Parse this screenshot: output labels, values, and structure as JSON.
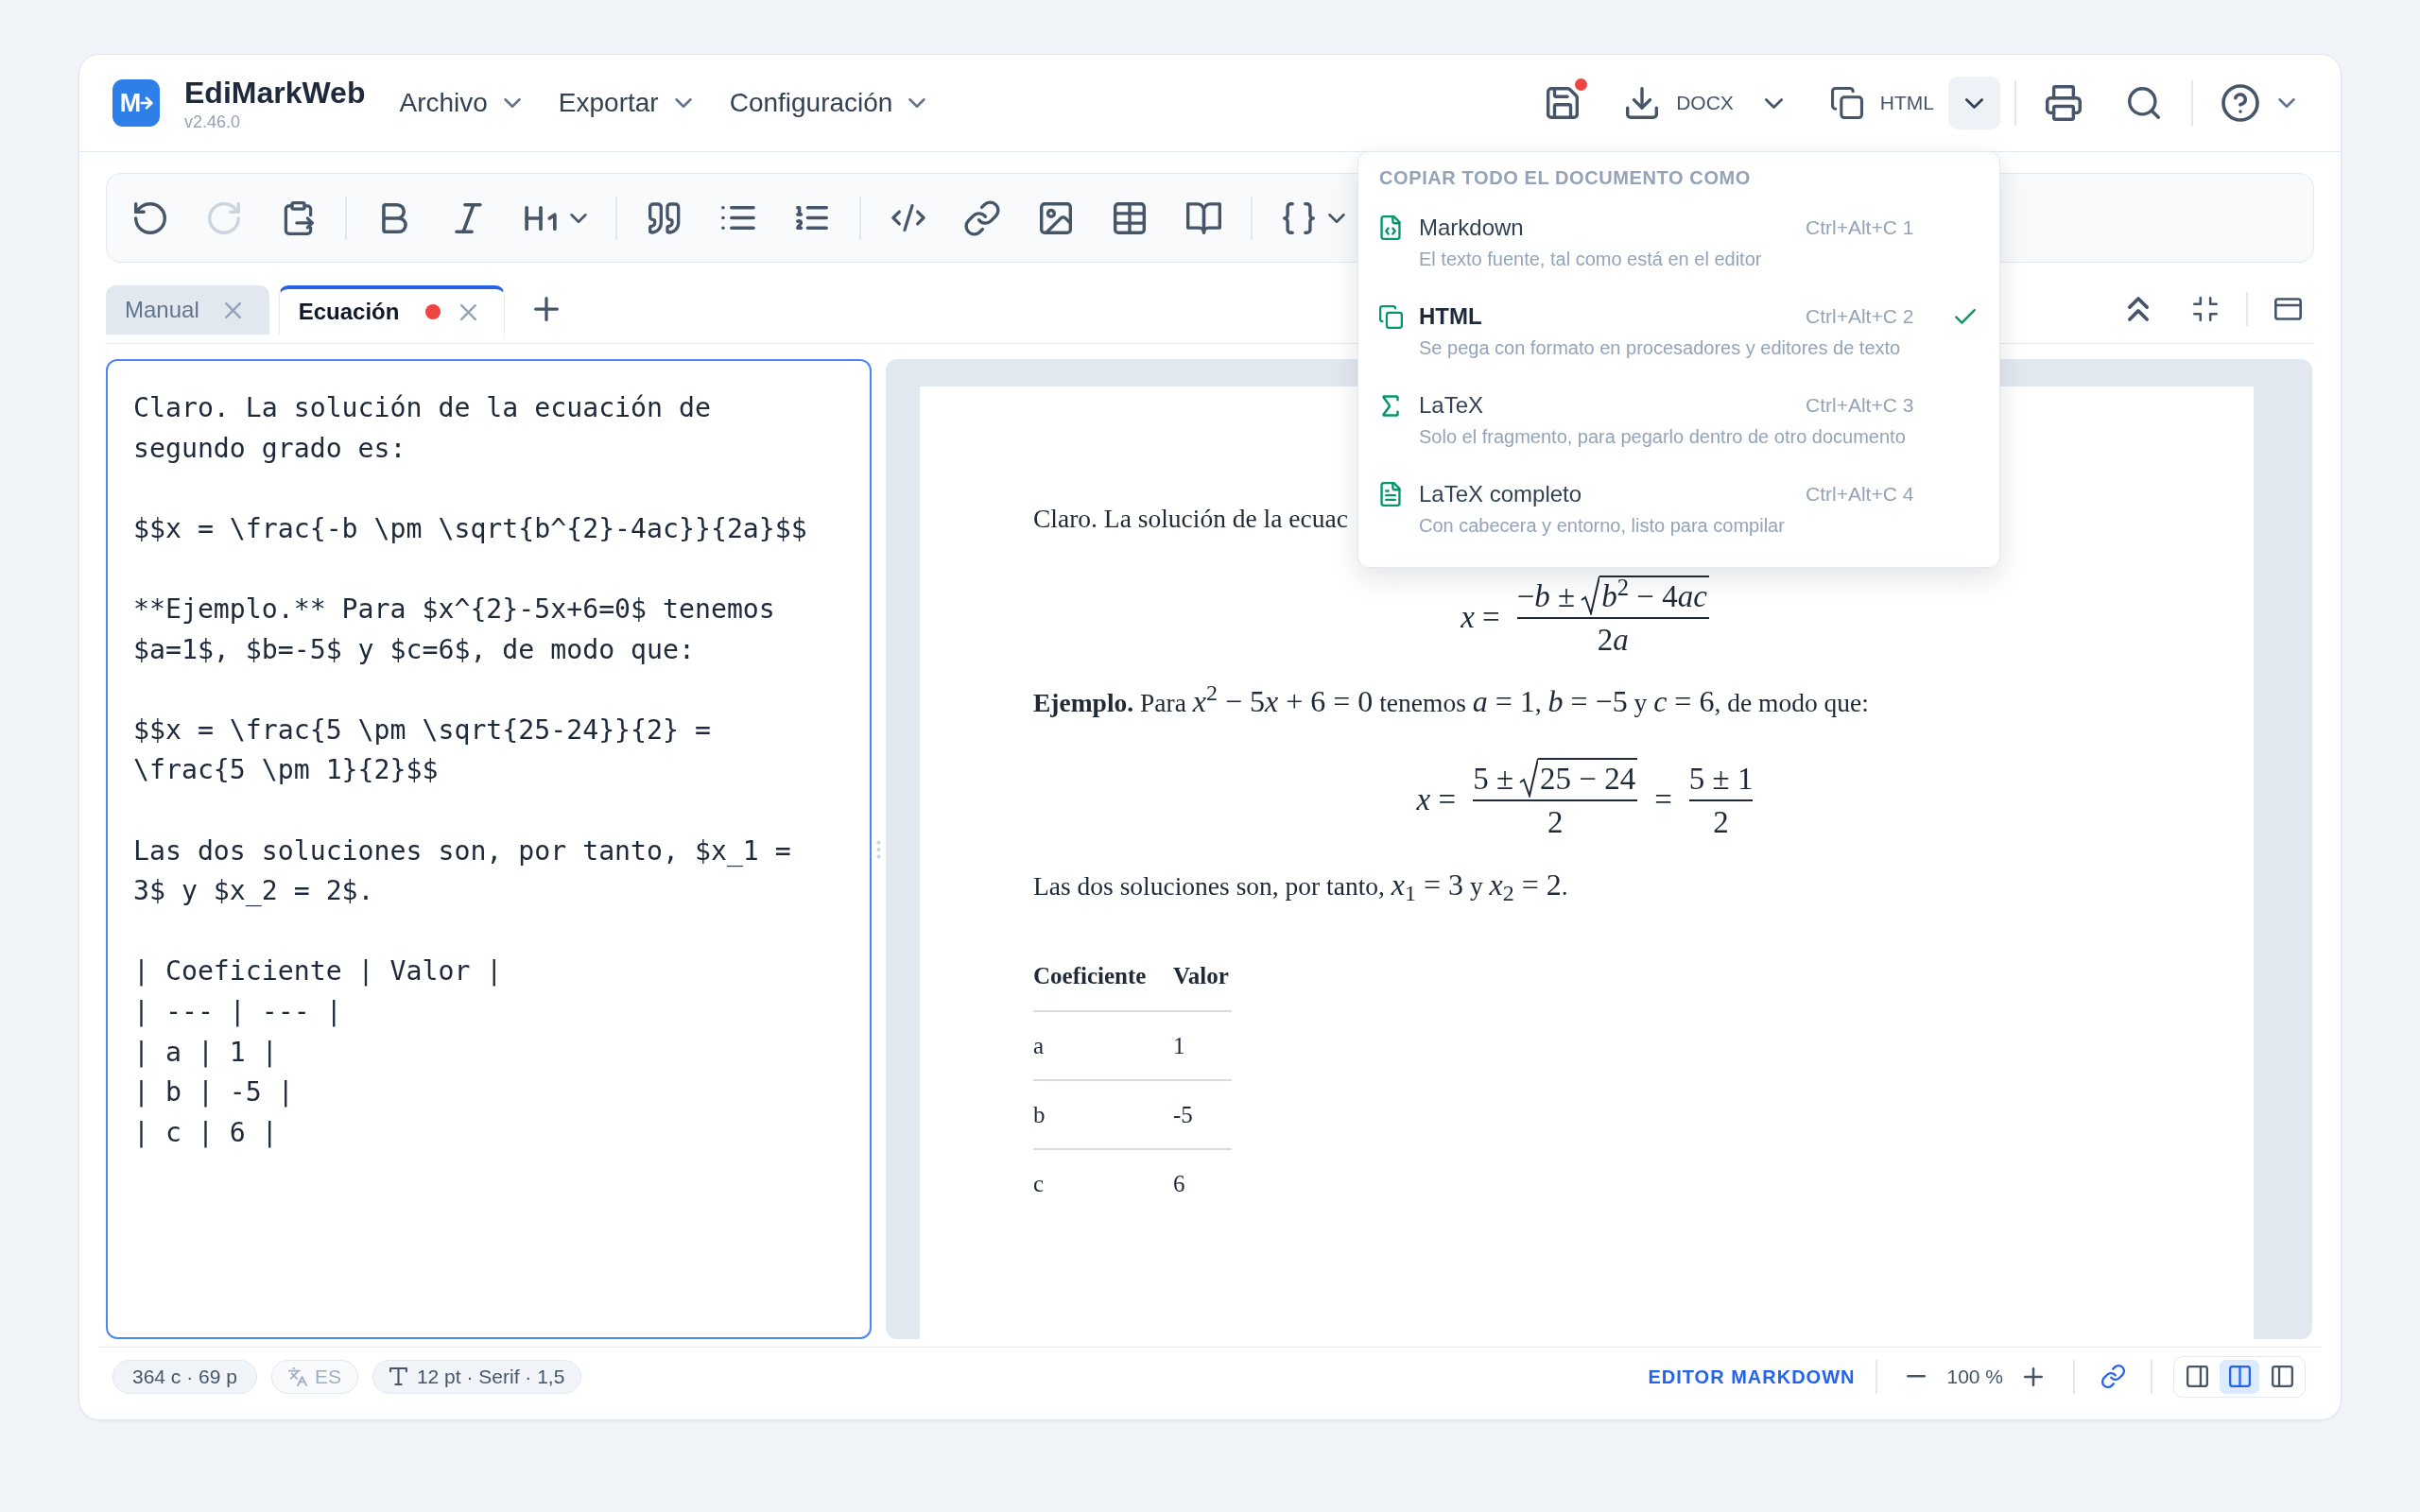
{
  "app": {
    "logo_letter": "M",
    "name": "EdiMarkWeb",
    "version": "v2.46.0"
  },
  "menus": [
    {
      "label": "Archivo"
    },
    {
      "label": "Exportar"
    },
    {
      "label": "Configuración"
    }
  ],
  "header": {
    "save": {
      "unsaved": true
    },
    "export": {
      "label": "DOCX"
    },
    "copy": {
      "label": "HTML"
    }
  },
  "toolbar": {
    "groups": [
      [
        {
          "kind": "undo",
          "disabled": false
        },
        {
          "kind": "redo",
          "disabled": true
        },
        {
          "kind": "paste",
          "disabled": false
        }
      ],
      [
        {
          "kind": "bold",
          "disabled": false
        },
        {
          "kind": "italic",
          "disabled": false
        },
        {
          "kind": "heading",
          "disabled": false
        }
      ],
      [
        {
          "kind": "quote",
          "disabled": false
        },
        {
          "kind": "bullet_list",
          "disabled": false
        },
        {
          "kind": "numbered_list",
          "disabled": false
        }
      ],
      [
        {
          "kind": "code",
          "disabled": false
        },
        {
          "kind": "link",
          "disabled": false
        },
        {
          "kind": "image",
          "disabled": false
        },
        {
          "kind": "table",
          "disabled": false
        },
        {
          "kind": "book",
          "disabled": false
        }
      ],
      [
        {
          "kind": "braces",
          "disabled": false
        }
      ]
    ]
  },
  "tabs": [
    {
      "label": "Manual",
      "selected": false,
      "modified": false
    },
    {
      "label": "Ecuación",
      "selected": true,
      "modified": true
    }
  ],
  "editor": {
    "blocks": [
      [
        "Claro. La solución de la ecuación de",
        "segundo grado es:"
      ],
      [
        "$$x = \\frac{-b \\pm \\sqrt{b^{2}-4ac}}{2a}$$"
      ],
      [
        "**Ejemplo.** Para $x^{2}-5x+6=0$ tenemos",
        "$a=1$, $b=-5$ y $c=6$, de modo que:"
      ],
      [
        "$$x = \\frac{5 \\pm \\sqrt{25-24}}{2} =",
        "\\frac{5 \\pm 1}{2}$$"
      ],
      [
        "Las dos soluciones son, por tanto, $x_1 =",
        "3$ y $x_2 = 2$."
      ],
      [
        "| Coeficiente | Valor |",
        "| --- | --- |",
        "| a | 1 |",
        "| b | -5 |",
        "| c | 6 |"
      ]
    ]
  },
  "preview": {
    "blocks": [
      {
        "kind": "paragraph",
        "runs": [
          {
            "kind": "text",
            "text": "Claro. La solución de la ecuac"
          }
        ]
      },
      {
        "kind": "display_math",
        "parts": [
          {
            "kind": "text",
            "text": "x ="
          },
          {
            "kind": "fraction",
            "numerator": "−b ±",
            "radicand": "b$^{2}$ − 4ac",
            "denominator": "2a"
          }
        ]
      },
      {
        "kind": "paragraph",
        "runs": [
          {
            "kind": "text",
            "text": "**Ejemplo.** Para "
          },
          {
            "kind": "math",
            "text": "x$^{2}$ − 5x + 6 = 0"
          },
          {
            "kind": "text",
            "text": " tenemos "
          },
          {
            "kind": "math",
            "text": "a = 1"
          },
          {
            "kind": "text",
            "text": ", "
          },
          {
            "kind": "math",
            "text": "b = −5"
          },
          {
            "kind": "text",
            "text": " y "
          },
          {
            "kind": "math",
            "text": "c = 6"
          },
          {
            "kind": "text",
            "text": ", de modo que:"
          }
        ]
      },
      {
        "kind": "display_math",
        "parts": [
          {
            "kind": "text",
            "text": "x ="
          },
          {
            "kind": "fraction",
            "numerator": "5 ±",
            "radicand": "25 − 24",
            "denominator": "2"
          },
          {
            "kind": "text",
            "text": "="
          },
          {
            "kind": "fraction",
            "numerator": "5 ± 1",
            "denominator": "2"
          }
        ]
      },
      {
        "kind": "paragraph",
        "runs": [
          {
            "kind": "text",
            "text": "Las dos soluciones son, por tanto, "
          },
          {
            "kind": "math",
            "text": "x$_{1}$ = 3"
          },
          {
            "kind": "text",
            "text": " y "
          },
          {
            "kind": "math",
            "text": "x$_{2}$ = 2"
          },
          {
            "kind": "text",
            "text": "."
          }
        ]
      },
      {
        "kind": "table",
        "columns": [
          "Coeficiente",
          "Valor"
        ],
        "rows": [
          [
            "a",
            "1"
          ],
          [
            "b",
            "-5"
          ],
          [
            "c",
            "6"
          ]
        ]
      }
    ]
  },
  "copy_menu": {
    "open": true,
    "heading": "COPIAR TODO EL DOCUMENTO COMO",
    "items": [
      {
        "kind": "markdown",
        "title": "Markdown",
        "shortcut": "Ctrl+Alt+C 1",
        "description": "El texto fuente, tal como está en el editor",
        "selected": false
      },
      {
        "kind": "html",
        "title": "HTML",
        "shortcut": "Ctrl+Alt+C 2",
        "description": "Se pega con formato en procesadores y editores de texto",
        "selected": true
      },
      {
        "kind": "latex",
        "title": "LaTeX",
        "shortcut": "Ctrl+Alt+C 3",
        "description": "Solo el fragmento, para pegarlo dentro de otro documento",
        "selected": false
      },
      {
        "kind": "latex_full",
        "title": "LaTeX completo",
        "shortcut": "Ctrl+Alt+C 4",
        "description": "Con cabecera y entorno, listo para compilar",
        "selected": false
      }
    ]
  },
  "status_bar": {
    "stats": "364 c · 69 p",
    "language": {
      "label": "ES",
      "active": false
    },
    "typography": "12 pt · Serif · 1,5",
    "mode": "EDITOR MARKDOWN",
    "zoom": "100 %",
    "scroll_sync": true,
    "view_modes": [
      {
        "kind": "editor",
        "selected": false
      },
      {
        "kind": "split",
        "selected": true
      },
      {
        "kind": "preview",
        "selected": false
      }
    ]
  }
}
